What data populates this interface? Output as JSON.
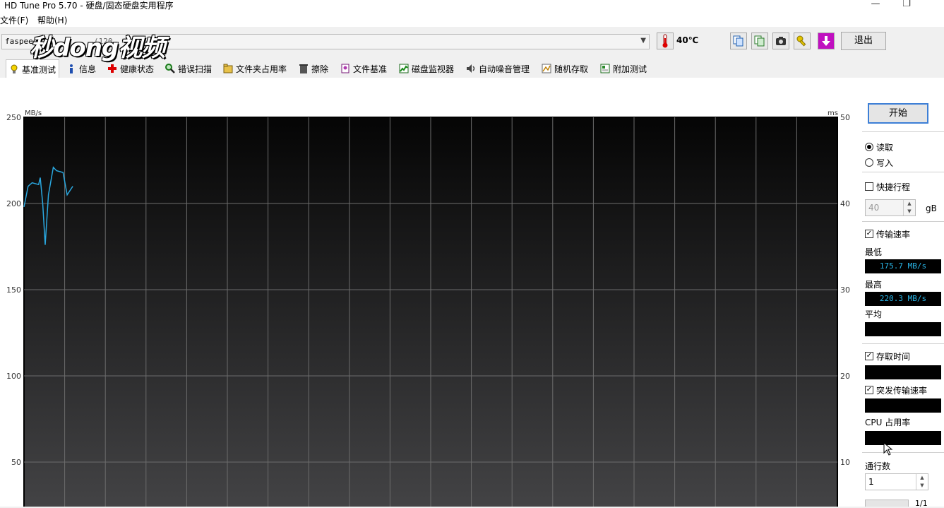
{
  "window": {
    "title": "HD Tune Pro 5.70 - 硬盘/固态硬盘实用程序"
  },
  "menu": {
    "file": "文件(F)",
    "help": "帮助(H)"
  },
  "toolbar": {
    "drive": "faspeed",
    "drive_suffix": "(120",
    "watermark": "秒dong视频",
    "temperature": "40℃",
    "exit_label": "退出",
    "icons": [
      "copy-icon",
      "copy-all-icon",
      "camera-icon",
      "key-icon",
      "download-icon"
    ]
  },
  "tabs": [
    {
      "label": "基准测试",
      "icon": "benchmark-icon"
    },
    {
      "label": "信息",
      "icon": "info-icon"
    },
    {
      "label": "健康状态",
      "icon": "health-icon"
    },
    {
      "label": "错误扫描",
      "icon": "search-icon"
    },
    {
      "label": "文件夹占用率",
      "icon": "folder-icon"
    },
    {
      "label": "擦除",
      "icon": "trash-icon"
    },
    {
      "label": "文件基准",
      "icon": "file-icon"
    },
    {
      "label": "磁盘监视器",
      "icon": "monitor-icon"
    },
    {
      "label": "自动噪音管理",
      "icon": "speaker-icon"
    },
    {
      "label": "随机存取",
      "icon": "random-icon"
    },
    {
      "label": "附加测试",
      "icon": "extra-icon"
    }
  ],
  "chart_data": {
    "type": "line",
    "ylabel_left": "MB/s",
    "ylabel_right": "ms",
    "y_left_ticks": [
      "250",
      "200",
      "150",
      "100",
      "50"
    ],
    "y_right_ticks": [
      "50",
      "40",
      "30",
      "20",
      "10"
    ],
    "ylim": [
      0,
      250
    ],
    "grid": true,
    "series": [
      {
        "x": [
          0,
          0.5,
          1.0,
          1.8,
          2.0,
          2.3,
          2.6,
          3.0,
          3.6,
          4.0,
          4.8,
          5.3,
          6.0
        ],
        "values": [
          198,
          210,
          212,
          211,
          215,
          200,
          176,
          205,
          221,
          219,
          218,
          205,
          210
        ]
      }
    ]
  },
  "controls": {
    "start_label": "开始",
    "read_label": "读取",
    "write_label": "写入",
    "short_stroke_label": "快捷行程",
    "short_stroke_value": "40",
    "gb_label": "gB",
    "transfer_rate_label": "传输速率",
    "min_label": "最低",
    "min_value": "175.7 MB/s",
    "max_label": "最高",
    "max_value": "220.3 MB/s",
    "avg_label": "平均",
    "access_time_label": "存取时间",
    "burst_rate_label": "突发传输速率",
    "cpu_label": "CPU 占用率",
    "passes_label": "通行数",
    "passes_value": "1",
    "pass_counter": "1/1"
  }
}
